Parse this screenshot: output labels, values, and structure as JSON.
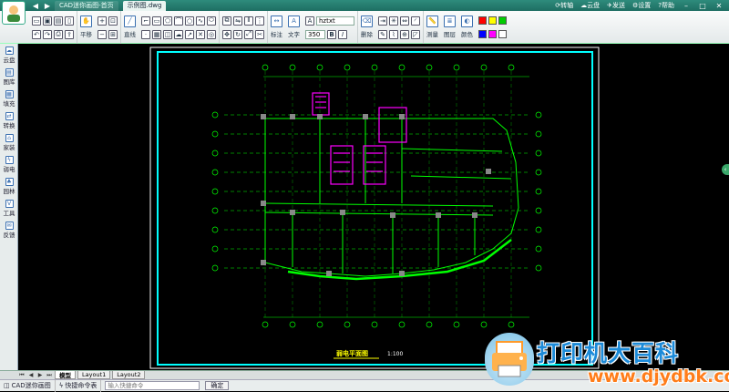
{
  "titlebar": {
    "tabs": [
      "CAD迷你画图-首页",
      "示例图.dwg"
    ],
    "actions": {
      "rotate": "转轴",
      "cloud": "云盘",
      "send": "发送",
      "settings": "设置",
      "help": "帮助"
    }
  },
  "ribbon": {
    "pan_label": "平移",
    "line_label": "直线",
    "marker_label": "标注",
    "text_label": "文字",
    "font_name": "hztxt",
    "font_size": "350",
    "bold_label": "B",
    "italic_label": "I",
    "delete_label": "删除",
    "layer_label": "图层",
    "color_label": "颜色",
    "measure_label": "测量",
    "swatches": [
      "#ff0000",
      "#ffff00",
      "#00cc00",
      "#0000ff",
      "#ff00ff",
      "#ffffff"
    ]
  },
  "sidebar": {
    "items": [
      "云盘",
      "图库",
      "填充",
      "转换",
      "家装",
      "弱电",
      "园林",
      "工具",
      "反馈"
    ]
  },
  "drawing": {
    "title": "弱电平面图",
    "scale": "1:100"
  },
  "layout_tabs": [
    "模型",
    "Layout1",
    "Layout2"
  ],
  "command_bar": {
    "app_name": "CAD迷你画图",
    "shortcut_label": "快捷命令表",
    "input_placeholder": "输入快捷命令",
    "ok_label": "确定"
  },
  "watermark": {
    "title": "打印机大百科",
    "url": "www.djydbk.com"
  },
  "colors": {
    "titlebar": "#2e8b7c",
    "frame": "#00ffff",
    "walls": "#00ff00",
    "magenta": "#ff00ff"
  }
}
